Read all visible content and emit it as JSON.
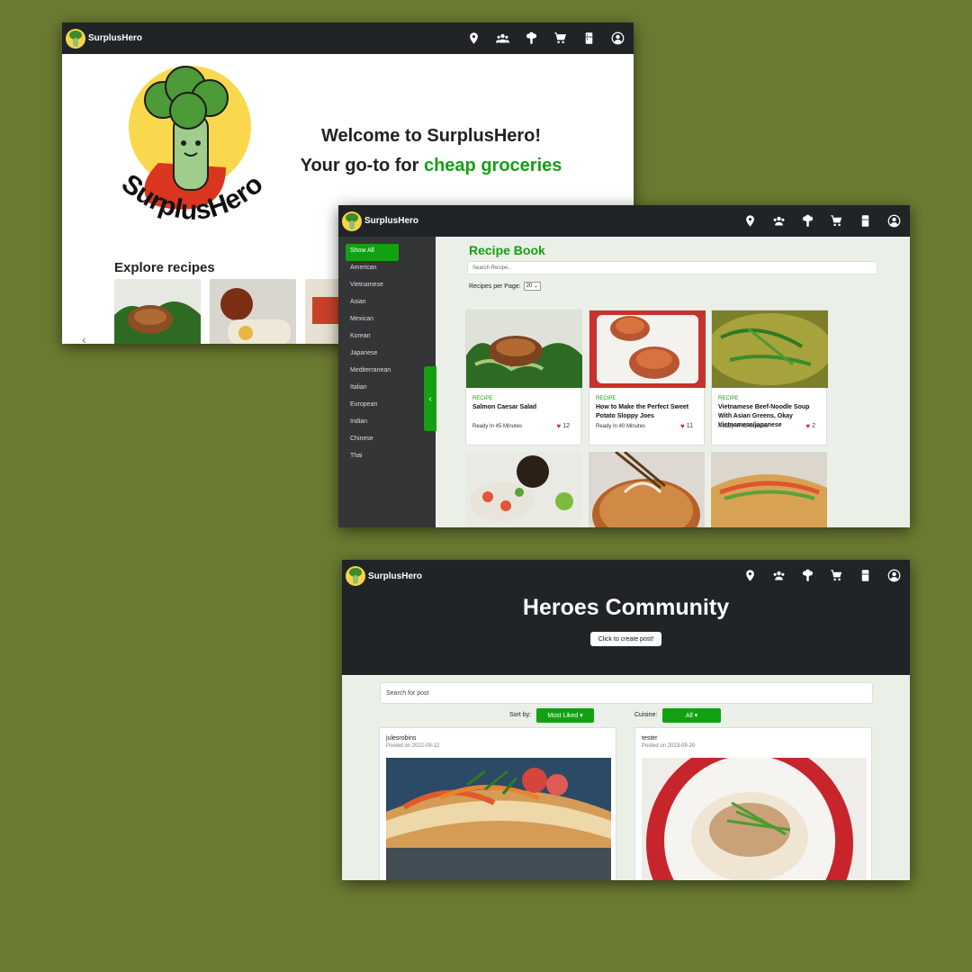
{
  "brand": {
    "name": "SurplusHero"
  },
  "nav": {
    "icons": [
      "location-icon",
      "community-icon",
      "broccoli-icon",
      "cart-icon",
      "fridge-icon",
      "account-icon"
    ]
  },
  "home": {
    "logo_text": "SurplusHero",
    "welcome_line1": "Welcome to SurplusHero!",
    "welcome_line2_prefix": "Your go-to for ",
    "welcome_line2_highlight": "cheap groceries",
    "explore_heading": "Explore recipes"
  },
  "recipe_book": {
    "title": "Recipe Book",
    "search_placeholder": "Search Recipe..",
    "per_page_label": "Recipes per Page:",
    "per_page_value": "20",
    "sidebar": [
      "Show All",
      "American",
      "Vietnamese",
      "Asian",
      "Mexican",
      "Korean",
      "Japanese",
      "Mediterranean",
      "Italian",
      "European",
      "Indian",
      "Chinese",
      "Thai"
    ],
    "cards": [
      {
        "tag": "RECIPE",
        "name": "Salmon Caesar Salad",
        "time": "Ready In 45 Minutes",
        "likes": "12"
      },
      {
        "tag": "RECIPE",
        "name": "How to Make the Perfect Sweet Potato Sloppy Joes",
        "time": "Ready In 40 Minutes",
        "likes": "11"
      },
      {
        "tag": "RECIPE",
        "name": "Vietnamese Beef-Noodle Soup With Asian Greens, Okay Vietnamese/japanese",
        "time": "Ready In 45 Minutes",
        "likes": "2"
      }
    ]
  },
  "community": {
    "title": "Heroes Community",
    "create_button": "Click to create post!",
    "search_placeholder": "Search for post",
    "sort_label": "Sort by:",
    "sort_value": "Most Liked",
    "cuisine_label": "Cuisine:",
    "cuisine_value": "All",
    "posts": [
      {
        "user": "julesrobins",
        "date": "Posted on 2022-09-12"
      },
      {
        "user": "tester",
        "date": "Posted on 2023-09-20"
      }
    ]
  },
  "colors": {
    "accent": "#13a113",
    "navbar": "#212427",
    "background": "#6b7b31"
  }
}
